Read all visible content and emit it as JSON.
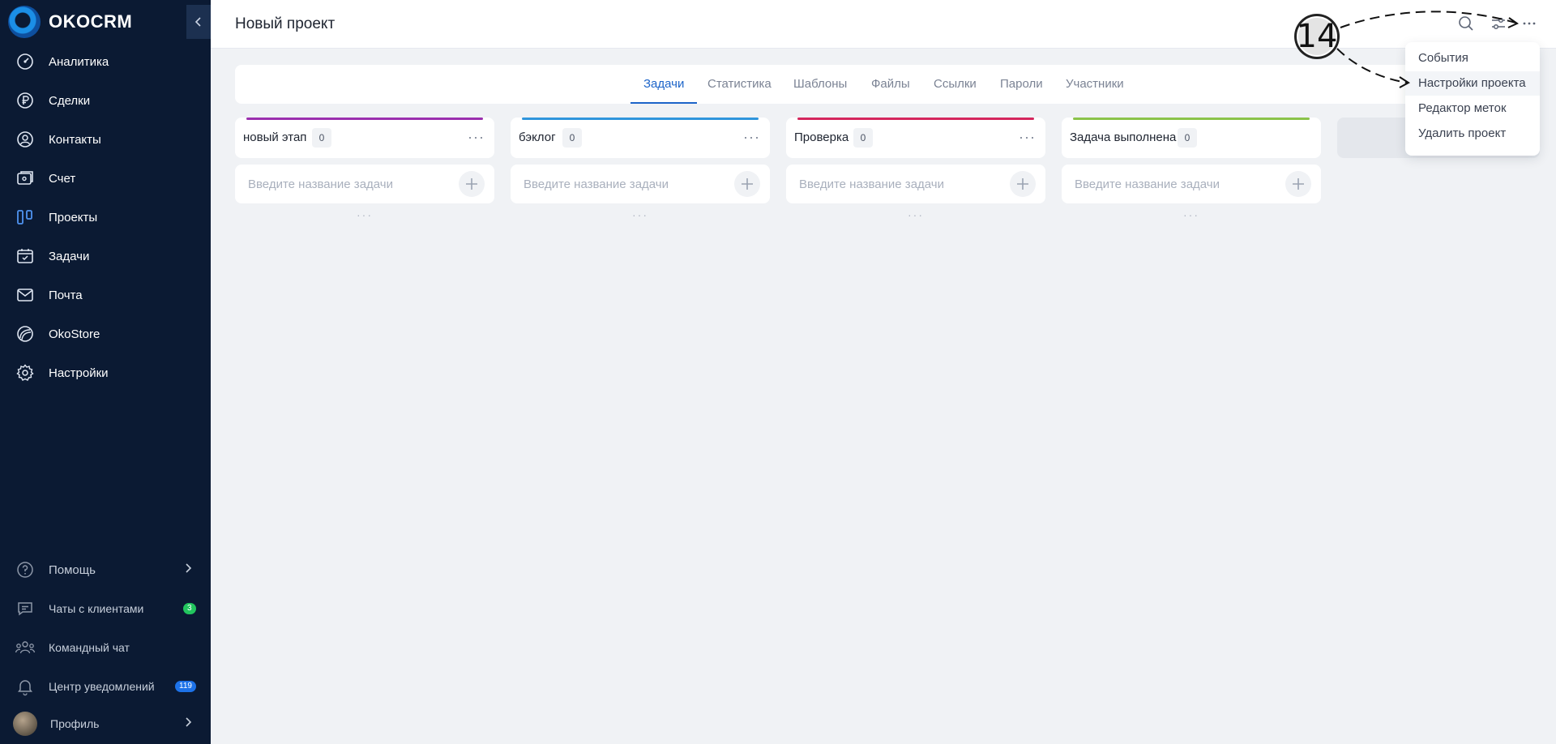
{
  "app": {
    "logo_text": "OKOCRM"
  },
  "sidebar": {
    "items": [
      {
        "label": "Аналитика",
        "icon": "analytics-icon"
      },
      {
        "label": "Сделки",
        "icon": "ruble-icon"
      },
      {
        "label": "Контакты",
        "icon": "contacts-icon"
      },
      {
        "label": "Счет",
        "icon": "invoice-icon"
      },
      {
        "label": "Проекты",
        "icon": "projects-icon",
        "active": true
      },
      {
        "label": "Задачи",
        "icon": "calendar-check-icon"
      },
      {
        "label": "Почта",
        "icon": "mail-icon"
      },
      {
        "label": "OkoStore",
        "icon": "store-icon"
      },
      {
        "label": "Настройки",
        "icon": "gear-icon"
      }
    ],
    "bottom": {
      "help": "Помощь",
      "client_chats": "Чаты с клиентами",
      "client_chats_badge": "3",
      "team_chat": "Командный чат",
      "notifications": "Центр уведомлений",
      "notifications_badge": "119",
      "profile": "Профиль"
    }
  },
  "header": {
    "title": "Новый проект"
  },
  "tabs": [
    {
      "label": "Задачи",
      "active": true
    },
    {
      "label": "Статистика"
    },
    {
      "label": "Шаблоны"
    },
    {
      "label": "Файлы"
    },
    {
      "label": "Ссылки"
    },
    {
      "label": "Пароли"
    },
    {
      "label": "Участники"
    }
  ],
  "columns": [
    {
      "name": "новый этап",
      "count": "0",
      "color": "#9b2fae"
    },
    {
      "name": "бэклог",
      "count": "0",
      "color": "#2f95dc"
    },
    {
      "name": "Проверка",
      "count": "0",
      "color": "#d4275d"
    },
    {
      "name": "Задача выполнена",
      "count": "0",
      "color": "#8bc34a"
    }
  ],
  "task_input": {
    "placeholder": "Введите название задачи"
  },
  "dropdown": {
    "items": [
      "События",
      "Настройки проекта",
      "Редактор меток",
      "Удалить проект"
    ]
  },
  "annotation": {
    "number": "14"
  },
  "colors": {
    "sidebar_bg": "#0b1a33",
    "accent": "#1c64c9",
    "badge_green": "#22c55e",
    "badge_blue": "#1d72e8"
  }
}
